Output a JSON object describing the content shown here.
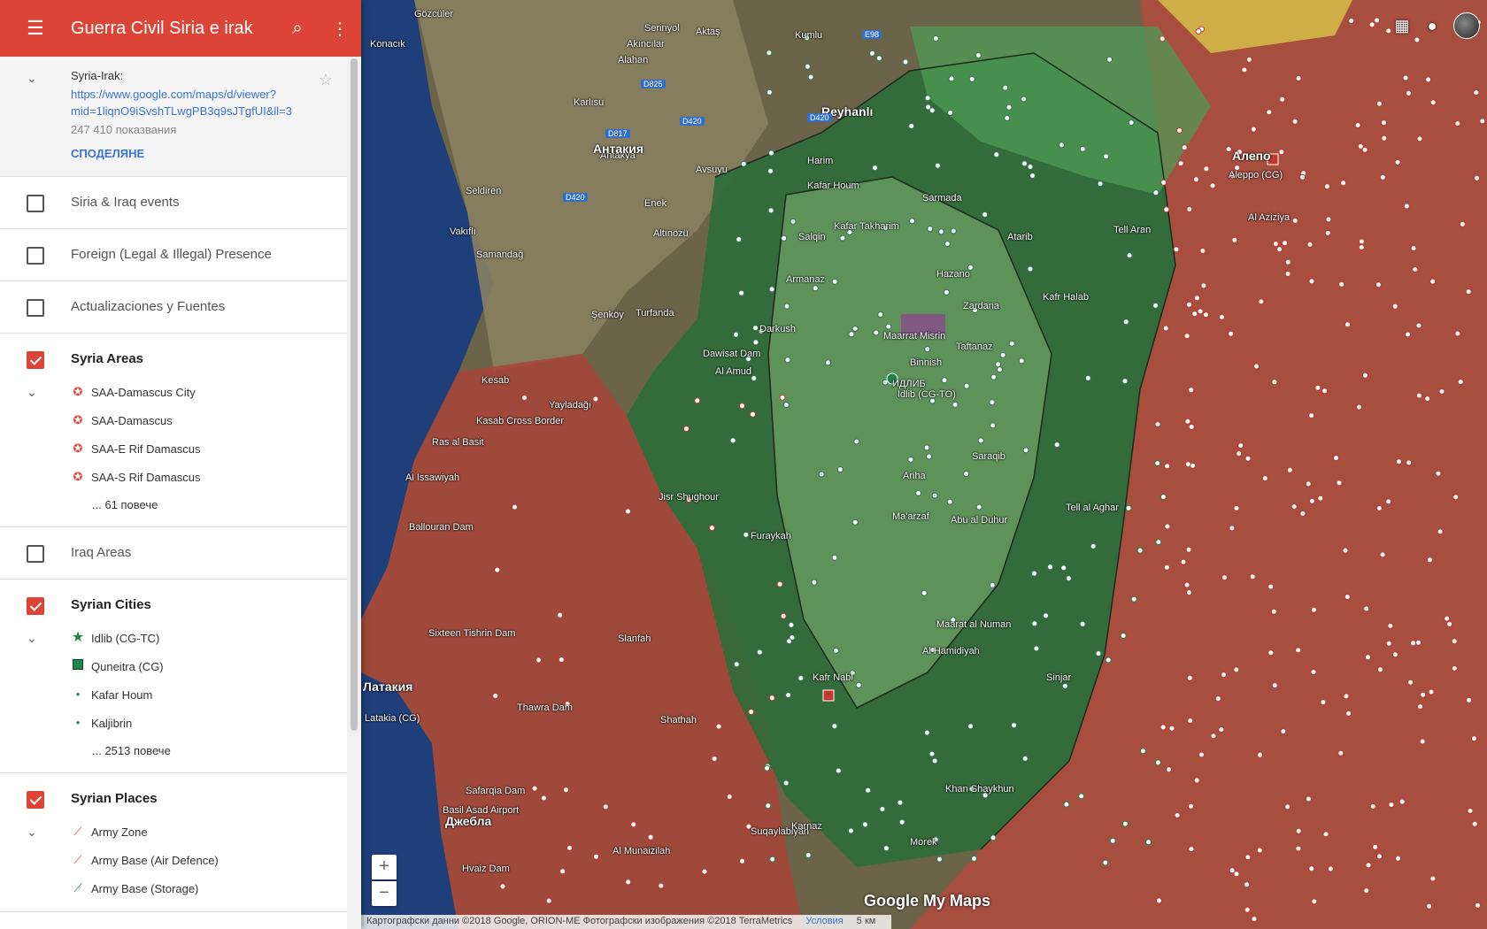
{
  "header": {
    "title": "Guerra Civil Siria e irak",
    "menu_icon": "menu-icon",
    "search_icon": "search-icon",
    "more_icon": "more-vert-icon"
  },
  "info": {
    "name": "Syria-Irak:",
    "link_line1": "https://www.google.com/maps/d/viewer?",
    "link_line2": "mid=1liqnO9iSvshTLwgPB3q9sJTgfUI&ll=3",
    "views": "247 410 показвания",
    "share": "СПОДЕЛЯНЕ"
  },
  "layers": [
    {
      "label": "Siria & Iraq events",
      "checked": false
    },
    {
      "label": "Foreign (Legal & Illegal) Presence",
      "checked": false
    },
    {
      "label": "Actualizaciones y Fuentes",
      "checked": false
    },
    {
      "label": "Syria Areas",
      "checked": true
    },
    {
      "label": "Iraq Areas",
      "checked": false
    },
    {
      "label": "Syrian Cities",
      "checked": true
    },
    {
      "label": "Syrian Places",
      "checked": true
    }
  ],
  "syria_areas": {
    "items": [
      "SAA-Damascus City",
      "SAA-Damascus",
      "SAA-E Rif Damascus",
      "SAA-S Rif Damascus"
    ],
    "more": "... 61 повече"
  },
  "syrian_cities": {
    "items": [
      "Idlib (CG-TC)",
      "Quneitra (CG)",
      "Kafar Houm",
      "Kaljibrin"
    ],
    "more": "... 2513 повече"
  },
  "syrian_places": {
    "items": [
      "Army Zone",
      "Army Base (Air Defence)",
      "Army Base (Storage)"
    ]
  },
  "colors": {
    "header": "#db4437",
    "gov_area": "#c0392b",
    "rebel_area": "#1e8449",
    "link": "#3b73d8"
  },
  "map": {
    "labels": [
      "Gözcüler",
      "Konacık",
      "Serinyol",
      "Akıncılar",
      "Aktaş",
      "Kumlu",
      "Alahan",
      "Reyhanlı",
      "Karlısu",
      "Antakya",
      "Антакия",
      "Avsuyu",
      "Kafar Houm",
      "Seldiren",
      "Enek",
      "Vakıflı",
      "Samandağ",
      "Altınözü",
      "Şenköy",
      "Turfanda",
      "Armanaz",
      "Darkush",
      "Salqin",
      "Kafar Takharim",
      "Harim",
      "Dawisat Dam",
      "Al Amud",
      "Idlib (CG-TO)",
      "ИДЛИБ",
      "Maarrat Misrin",
      "Taftanaz",
      "Sarmada",
      "Hazano",
      "Zardana",
      "Atarib",
      "Kafr Halab",
      "Binnish",
      "Saraqib",
      "Tell Aran",
      "Алепо",
      "Aleppo (CG)",
      "Al Aziziya",
      "Kasab Cross Border",
      "Yayladağı",
      "Kesab",
      "Ras al Basit",
      "Al Issawiyah",
      "Ballouran Dam",
      "Jisr Shughour",
      "Furaykah",
      "Ariha",
      "Ma'arzaf",
      "Maarat al Numan",
      "Kafr Nabl",
      "Khan Shaykhun",
      "Латакия",
      "Latakia (CG)",
      "Джебла",
      "Basil Asad Airport",
      "Hvaiz Dam",
      "Safarqia Dam",
      "Thawra Dam",
      "Sixteen Tishrin Dam",
      "Slanfah",
      "Shathah",
      "Al Munaizilah",
      "Suqaylabiyah",
      "Karnaz",
      "Morek",
      "Sinjar",
      "Abu al Duhur",
      "Al Hamidiyah",
      "Tell al Aghar"
    ],
    "roads": [
      "D825",
      "D817",
      "D420",
      "D420",
      "D420",
      "E98"
    ],
    "zoom_in": "+",
    "zoom_out": "−",
    "attribution": "Картографски данни ©2018 Google, ORION-ME Фотографски изображения ©2018 TerraMetrics",
    "terms": "Условия",
    "scale": "5 км",
    "brand": "Google My Maps"
  }
}
